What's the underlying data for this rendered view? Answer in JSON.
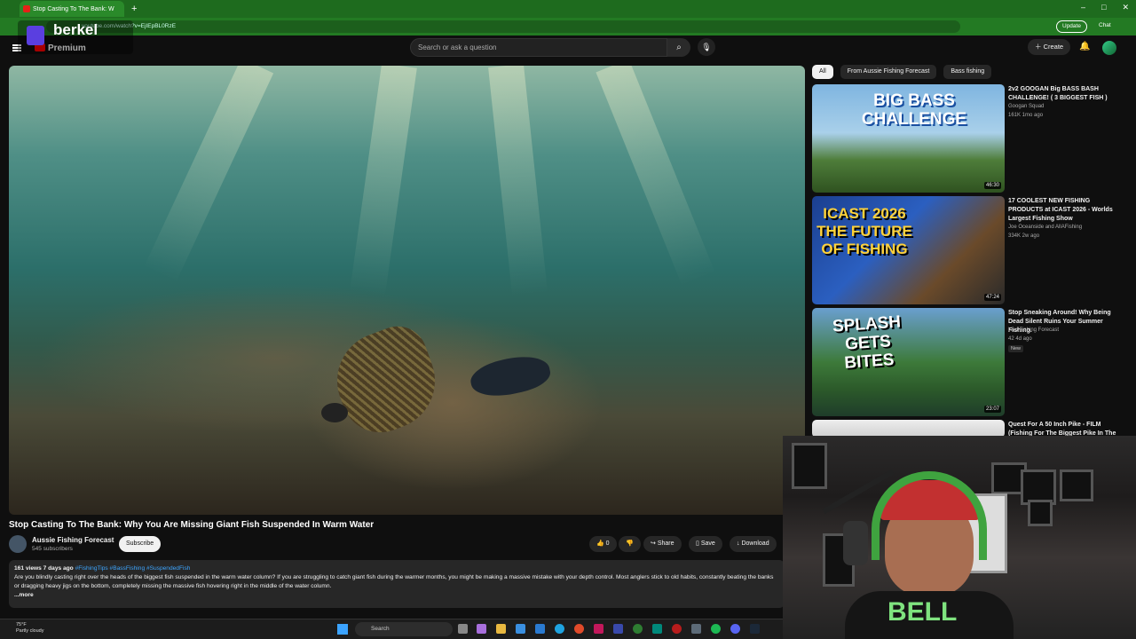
{
  "browser": {
    "tab_title": "Stop Casting To The Bank: W",
    "url": "youtube.com/watch?v=EjIEpBL0RzE",
    "update_label": "Update",
    "chat_label": "Chat"
  },
  "overlay": {
    "logo_text": "berkel"
  },
  "youtube": {
    "premium_label": "Premium",
    "search_placeholder": "Search or ask a question",
    "create_label": "Create"
  },
  "video": {
    "title": "Stop Casting To The Bank: Why You Are Missing Giant Fish Suspended In Warm Water",
    "channel": "Aussie Fishing Forecast",
    "subscribers": "545 subscribers",
    "subscribe_label": "Subscribe",
    "likes": "0",
    "share_label": "Share",
    "save_label": "Save",
    "download_label": "Download",
    "views": "161 views  7 days ago",
    "tags": "#FishingTips #BassFishing #SuspendedFish",
    "description": "Are you blindly casting right over the heads of the biggest fish suspended in the warm water column? If you are struggling to catch giant fish during the warmer months, you might be making a massive mistake with your depth control. Most anglers stick to old habits, constantly beating the banks or dragging heavy jigs on the bottom, completely missing the massive fish hovering right in the middle of the water column.",
    "more_label": "...more"
  },
  "chips": [
    "All",
    "From Aussie Fishing Forecast",
    "Bass fishing"
  ],
  "recommendations": [
    {
      "title": "2v2 GOOGAN Big BASS BASH CHALLENGE! ( 3 BIGGEST FISH )",
      "channel": "Googan Squad",
      "meta": "161K  1mo ago",
      "duration": "46:30",
      "thumb_text": "BIG BASS CHALLENGE",
      "badge": ""
    },
    {
      "title": "17 COOLEST NEW FISHING PRODUCTS at ICAST 2026 - Worlds Largest Fishing Show",
      "channel": "Joe Oceanside  and AllAFishing",
      "meta": "334K  2w ago",
      "duration": "47:24",
      "thumb_text": "ICAST 2026 THE FUTURE OF FISHING",
      "badge": ""
    },
    {
      "title": "Stop Sneaking Around! Why Being Dead Silent Ruins Your Summer Fishing.",
      "channel": "Kiwi Fishing Forecast",
      "meta": "42  4d ago",
      "duration": "23:07",
      "thumb_text": "SPLASH GETS BITES",
      "badge": "New"
    },
    {
      "title": "Quest For A 50 Inch Pike - FILM (Fishing For The Biggest Pike In The World)",
      "channel": "",
      "meta": "",
      "duration": "",
      "thumb_text": "",
      "badge": ""
    }
  ],
  "webcam": {
    "shirt_text": "BELL"
  },
  "taskbar": {
    "weather_temp": "75°F",
    "weather_desc": "Partly cloudy",
    "search_label": "Search"
  }
}
